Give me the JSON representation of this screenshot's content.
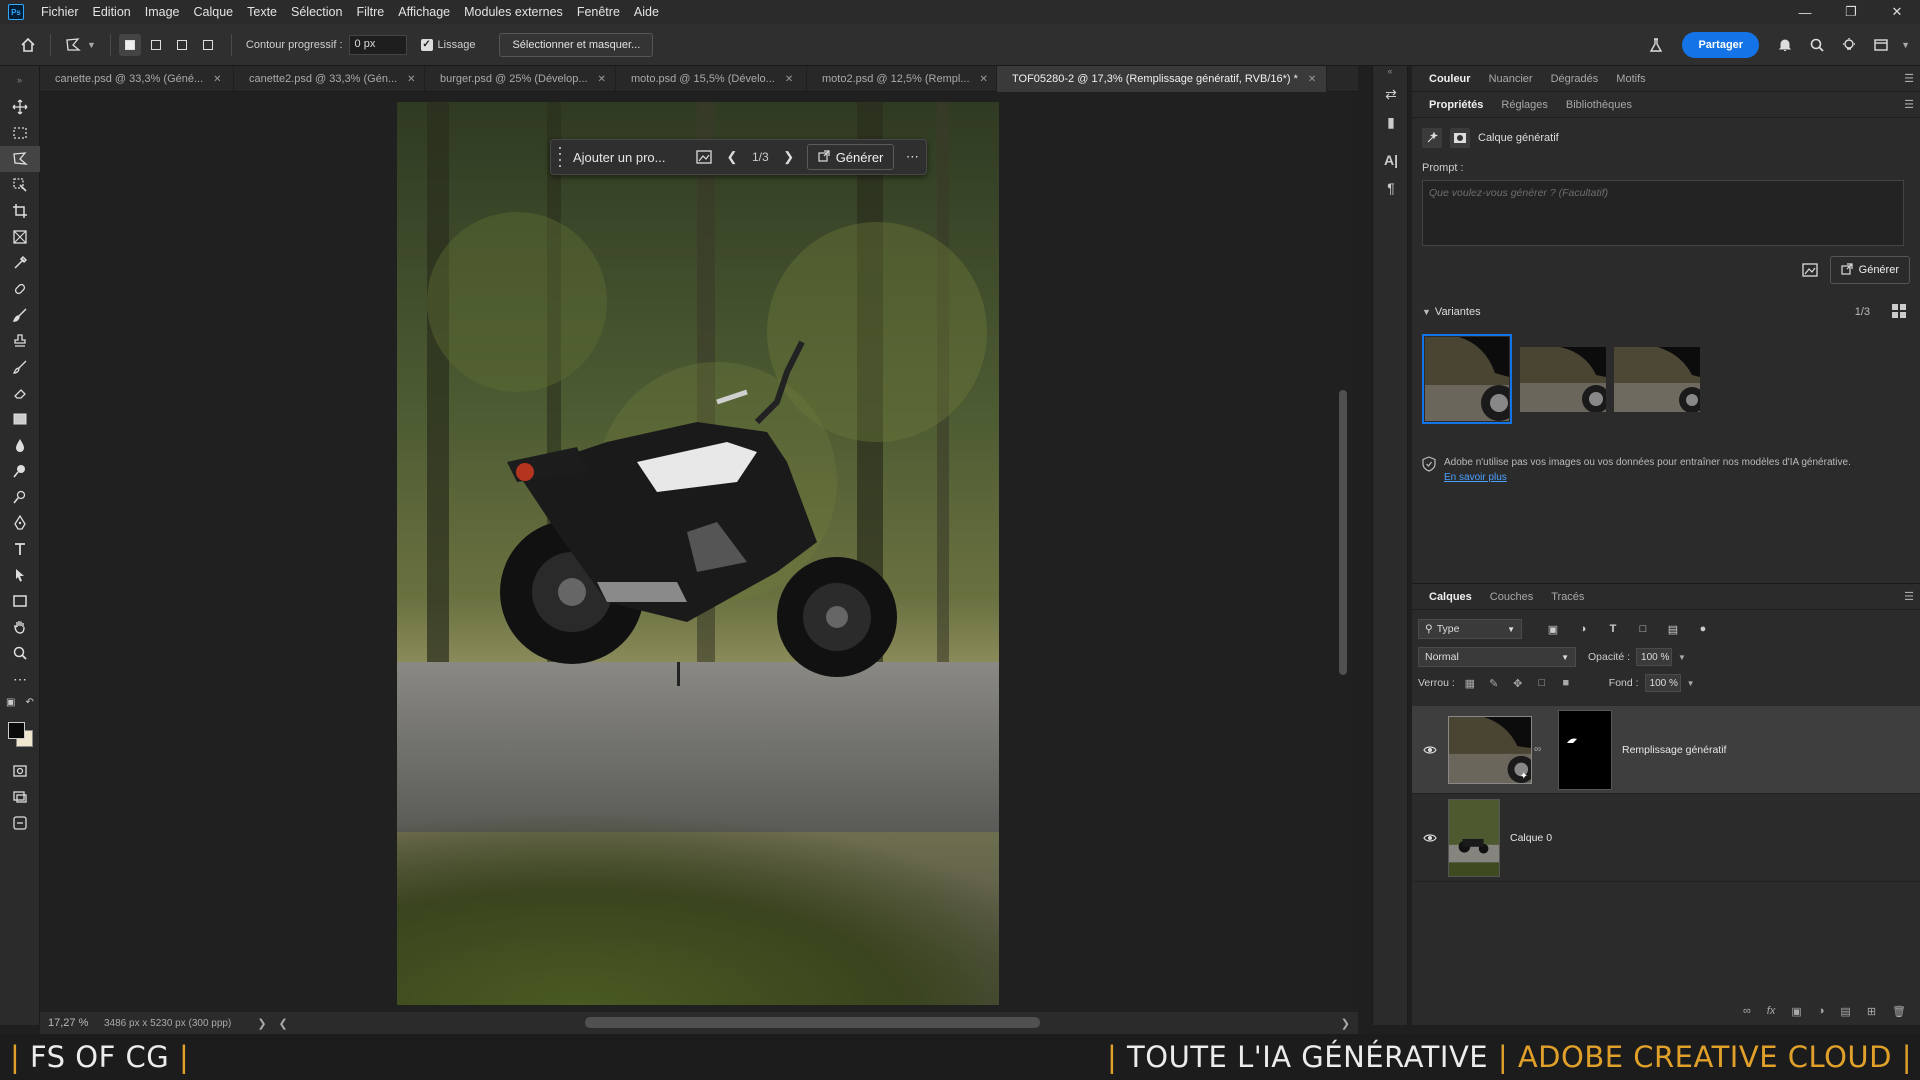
{
  "app": {
    "logo": "Ps"
  },
  "menu": [
    "Fichier",
    "Edition",
    "Image",
    "Calque",
    "Texte",
    "Sélection",
    "Filtre",
    "Affichage",
    "Modules externes",
    "Fenêtre",
    "Aide"
  ],
  "options": {
    "feather_label": "Contour progressif :",
    "feather_value": "0 px",
    "smoothing_label": "Lissage",
    "select_mask_button": "Sélectionner et masquer...",
    "share_button": "Partager"
  },
  "tabs": [
    {
      "label": "canette.psd @ 33,3% (Géné...",
      "active": false
    },
    {
      "label": "canette2.psd @ 33,3% (Gén...",
      "active": false
    },
    {
      "label": "burger.psd @ 25% (Dévelop...",
      "active": false
    },
    {
      "label": "moto.psd @ 15,5% (Dévelo...",
      "active": false
    },
    {
      "label": "moto2.psd @ 12,5% (Rempl...",
      "active": false
    },
    {
      "label": "TOF05280-2 @ 17,3% (Remplissage génératif, RVB/16*) *",
      "active": true
    }
  ],
  "context_bar": {
    "input_text": "Ajouter un pro...",
    "count": "1/3",
    "generate": "Générer"
  },
  "status": {
    "zoom": "17,27 %",
    "doc_info": "3486 px x 5230 px (300 ppp)"
  },
  "panels": {
    "top_tabs": [
      "Couleur",
      "Nuancier",
      "Dégradés",
      "Motifs"
    ],
    "prop_tabs": [
      "Propriétés",
      "Réglages",
      "Bibliothèques"
    ],
    "layer_type_label": "Calque génératif",
    "prompt_label": "Prompt :",
    "prompt_placeholder": "Que voulez-vous générer ? (Facultatif)",
    "generate_button": "Générer",
    "variants_title": "Variantes",
    "variants_count": "1/3",
    "notice_text": "Adobe n'utilise pas vos images ou vos données pour entraîner nos modèles d'IA générative.",
    "notice_link": "En savoir plus"
  },
  "layers_panel": {
    "tabs": [
      "Calques",
      "Couches",
      "Tracés"
    ],
    "filter": "Type",
    "blend_mode": "Normal",
    "opacity_label": "Opacité :",
    "opacity_value": "100 %",
    "lock_label": "Verrou :",
    "fill_label": "Fond :",
    "fill_value": "100 %",
    "layers": [
      {
        "name": "Remplissage génératif",
        "active": true
      },
      {
        "name": "Calque 0",
        "active": false
      }
    ]
  },
  "banner": {
    "left": "FS OF CG",
    "right_white": "TOUTE L'IA GÉNÉRATIVE",
    "right_yellow": "ADOBE CREATIVE CLOUD"
  },
  "colors": {
    "accent": "#1473e6",
    "banner_yellow": "#e0a02a"
  }
}
